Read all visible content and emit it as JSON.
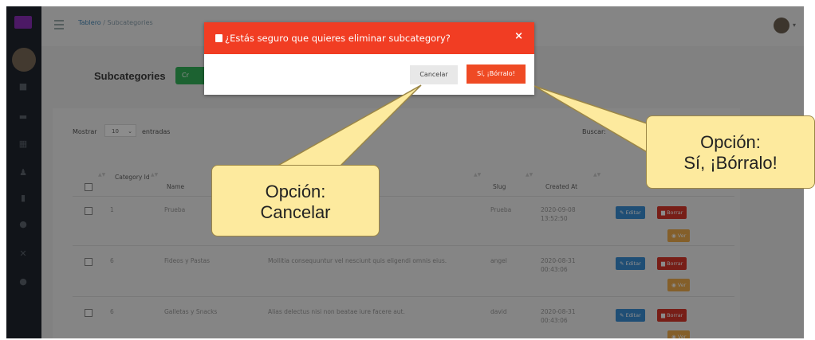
{
  "breadcrumb": {
    "home": "Tablero",
    "separator": "/",
    "current": "Subcategories"
  },
  "header": {
    "title": "Subcategories",
    "create_button": "Cr"
  },
  "table_controls": {
    "show_label": "Mostrar",
    "page_size": "10",
    "entries_label": "entradas",
    "search_label": "Buscar:"
  },
  "table": {
    "columns": [
      "Category Id",
      "Name",
      "Slug",
      "Created At"
    ],
    "rows": [
      {
        "category_id": "1",
        "name": "Prueba",
        "description": "",
        "slug": "Prueba",
        "created_at": "2020-09-08 13:52:50"
      },
      {
        "category_id": "6",
        "name": "Fideos y Pastas",
        "description": "Mollitia consequuntur vel nesciunt quis eligendi omnis eius.",
        "slug": "angel",
        "created_at": "2020-08-31 00:43:06"
      },
      {
        "category_id": "6",
        "name": "Galletas y Snacks",
        "description": "Alias delectus nisi non beatae iure facere aut.",
        "slug": "david",
        "created_at": "2020-08-31 00:43:06"
      }
    ],
    "actions": {
      "edit": "Editar",
      "delete": "Borrar",
      "view": "Ver"
    }
  },
  "modal": {
    "title": "¿Estás seguro que quieres eliminar subcategory?",
    "close": "×",
    "cancel_label": "Cancelar",
    "confirm_label": "Sí, ¡Bórralo!"
  },
  "callouts": {
    "cancel": {
      "line1": "Opción:",
      "line2": "Cancelar"
    },
    "confirm": {
      "line1": "Opción:",
      "line2": "Sí, ¡Bórralo!"
    }
  },
  "colors": {
    "modal_header": "#f13d23",
    "confirm_button": "#ef4a24",
    "callout_fill": "#fdea9e",
    "sidebar": "#20262f"
  }
}
